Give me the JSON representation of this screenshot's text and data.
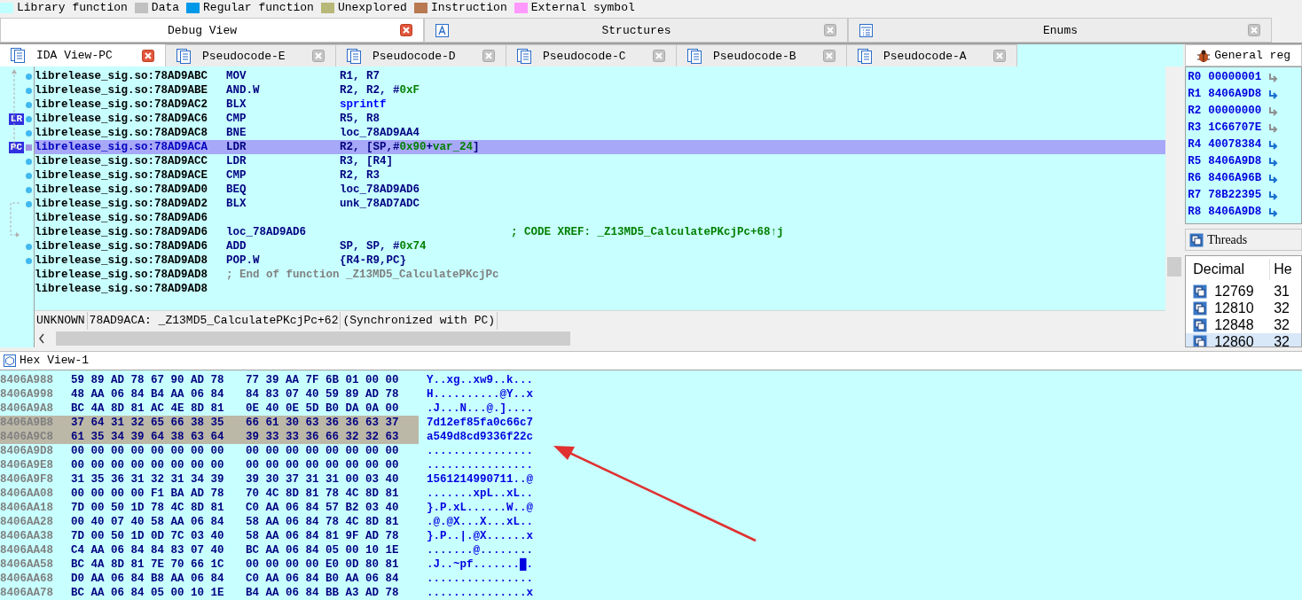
{
  "legend": [
    {
      "label": "Library function",
      "color": "#c0ffff"
    },
    {
      "label": "Data",
      "color": "#c0c0c0"
    },
    {
      "label": "Regular function",
      "color": "#0098e8"
    },
    {
      "label": "Unexplored",
      "color": "#b8b878"
    },
    {
      "label": "Instruction",
      "color": "#b87850"
    },
    {
      "label": "External symbol",
      "color": "#ff98ff"
    }
  ],
  "top_tabs": [
    {
      "label": "Debug View",
      "kind": "plain",
      "selected": true
    },
    {
      "label": "Structures",
      "kind": "struct",
      "selected": false
    },
    {
      "label": "Enums",
      "kind": "enum",
      "selected": false
    }
  ],
  "view_tabs": [
    {
      "label": "IDA View-PC",
      "selected": true
    },
    {
      "label": "Pseudocode-E",
      "selected": false
    },
    {
      "label": "Pseudocode-D",
      "selected": false
    },
    {
      "label": "Pseudocode-C",
      "selected": false
    },
    {
      "label": "Pseudocode-B",
      "selected": false
    },
    {
      "label": "Pseudocode-A",
      "selected": false
    }
  ],
  "code": {
    "lines": [
      {
        "address": "librelease_sig.so:78AD9ABC",
        "mnemonic": "MOV",
        "operands": [
          {
            "text": "R1, R7",
            "kind": "reg"
          }
        ],
        "dot": true,
        "selected": false
      },
      {
        "address": "librelease_sig.so:78AD9ABE",
        "mnemonic": "AND.W",
        "operands": [
          {
            "text": "R2, R2, #",
            "kind": "reg"
          },
          {
            "text": "0xF",
            "kind": "num"
          }
        ],
        "dot": true,
        "selected": false
      },
      {
        "address": "librelease_sig.so:78AD9AC2",
        "mnemonic": "BLX",
        "operands": [
          {
            "text": "sprintf",
            "kind": "func"
          }
        ],
        "dot": true,
        "selected": false
      },
      {
        "address": "librelease_sig.so:78AD9AC6",
        "mnemonic": "CMP",
        "operands": [
          {
            "text": "R5, R8",
            "kind": "reg"
          }
        ],
        "dot": true,
        "marker": "LR",
        "selected": false
      },
      {
        "address": "librelease_sig.so:78AD9AC8",
        "mnemonic": "BNE",
        "operands": [
          {
            "text": "loc_78AD9AA4",
            "kind": "reg"
          }
        ],
        "dot": true,
        "selected": false
      },
      {
        "address": "librelease_sig.so:78AD9ACA",
        "mnemonic": "LDR",
        "operands": [
          {
            "text": "R2, [SP,#",
            "kind": "reg"
          },
          {
            "text": "0x90",
            "kind": "num"
          },
          {
            "text": "+",
            "kind": "reg"
          },
          {
            "text": "var_24",
            "kind": "num"
          },
          {
            "text": "]",
            "kind": "reg"
          }
        ],
        "dot": true,
        "marker": "PC",
        "selected": true
      },
      {
        "address": "librelease_sig.so:78AD9ACC",
        "mnemonic": "LDR",
        "operands": [
          {
            "text": "R3, [R4]",
            "kind": "reg"
          }
        ],
        "dot": true,
        "selected": false
      },
      {
        "address": "librelease_sig.so:78AD9ACE",
        "mnemonic": "CMP",
        "operands": [
          {
            "text": "R2, R3",
            "kind": "reg"
          }
        ],
        "dot": true,
        "selected": false
      },
      {
        "address": "librelease_sig.so:78AD9AD0",
        "mnemonic": "BEQ",
        "operands": [
          {
            "text": "loc_78AD9AD6",
            "kind": "reg"
          }
        ],
        "dot": true,
        "selected": false
      },
      {
        "address": "librelease_sig.so:78AD9AD2",
        "mnemonic": "BLX",
        "operands": [
          {
            "text": "unk_78AD7ADC",
            "kind": "reg"
          }
        ],
        "dot": true,
        "selected": false
      },
      {
        "address": "librelease_sig.so:78AD9AD6",
        "dot": false,
        "selected": false
      },
      {
        "address": "librelease_sig.so:78AD9AD6",
        "label": "loc_78AD9AD6",
        "comment": {
          "text": "; CODE XREF: _Z13MD5_CalculatePKcjPc+68↑j",
          "kind": "xref"
        },
        "dot": false,
        "selected": false
      },
      {
        "address": "librelease_sig.so:78AD9AD6",
        "mnemonic": "ADD",
        "operands": [
          {
            "text": "SP, SP, #",
            "kind": "reg"
          },
          {
            "text": "0x74",
            "kind": "num"
          }
        ],
        "dot": true,
        "selected": false
      },
      {
        "address": "librelease_sig.so:78AD9AD8",
        "mnemonic": "POP.W",
        "operands": [
          {
            "text": "{R4-R9,PC}",
            "kind": "reg"
          }
        ],
        "dot": true,
        "selected": false
      },
      {
        "address": "librelease_sig.so:78AD9AD8",
        "label_comment": "; End of function _Z13MD5_CalculatePKcjPc",
        "dot": false,
        "selected": false
      },
      {
        "address": "librelease_sig.so:78AD9AD8",
        "dot": false,
        "selected": false
      }
    ],
    "status": [
      "UNKNOWN",
      "78AD9ACA: _Z13MD5_CalculatePKcjPc+62",
      "(Synchronized with PC)"
    ]
  },
  "registers": {
    "title": "General reg",
    "rows": [
      {
        "name": "R0",
        "value": "00000001",
        "pointer": false
      },
      {
        "name": "R1",
        "value": "8406A9D8",
        "pointer": true
      },
      {
        "name": "R2",
        "value": "00000000",
        "pointer": false
      },
      {
        "name": "R3",
        "value": "1C66707E",
        "pointer": false
      },
      {
        "name": "R4",
        "value": "40078384",
        "pointer": true
      },
      {
        "name": "R5",
        "value": "8406A9D8",
        "pointer": true
      },
      {
        "name": "R6",
        "value": "8406A96B",
        "pointer": true
      },
      {
        "name": "R7",
        "value": "78B22395",
        "pointer": true
      },
      {
        "name": "R8",
        "value": "8406A9D8",
        "pointer": true
      }
    ]
  },
  "threads": {
    "title": "Threads",
    "columns": [
      "Decimal",
      "He"
    ],
    "rows": [
      {
        "decimal": "12769",
        "hex": "31",
        "selected": false
      },
      {
        "decimal": "12810",
        "hex": "32",
        "selected": false
      },
      {
        "decimal": "12848",
        "hex": "32",
        "selected": false
      },
      {
        "decimal": "12860",
        "hex": "32",
        "selected": true
      }
    ]
  },
  "hex_view": {
    "title": "Hex View-1",
    "rows": [
      {
        "address": "8406A988",
        "bytes_1": "59 89 AD 78 67 90 AD 78",
        "bytes_2": "77 39 AA 7F 6B 01 00 00",
        "ascii": "Y..xg..xw9..k...",
        "selected": false
      },
      {
        "address": "8406A998",
        "bytes_1": "48 AA 06 84 B4 AA 06 84",
        "bytes_2": "84 83 07 40 59 89 AD 78",
        "ascii": "H..........@Y..x",
        "selected": false
      },
      {
        "address": "8406A9A8",
        "bytes_1": "BC 4A 8D 81 AC 4E 8D 81",
        "bytes_2": "0E 40 0E 5D B0 DA 0A 00",
        "ascii": ".J...N...@.]....",
        "selected": false
      },
      {
        "address": "8406A9B8",
        "bytes_1": "37 64 31 32 65 66 38 35",
        "bytes_2": "66 61 30 63 36 36 63 37",
        "ascii": "7d12ef85fa0c66c7",
        "selected": true
      },
      {
        "address": "8406A9C8",
        "bytes_1": "61 35 34 39 64 38 63 64",
        "bytes_2": "39 33 33 36 66 32 32 63",
        "ascii": "a549d8cd9336f22c",
        "selected": true
      },
      {
        "address": "8406A9D8",
        "bytes_1": "00 00 00 00 00 00 00 00",
        "bytes_2": "00 00 00 00 00 00 00 00",
        "ascii": "................",
        "selected": false
      },
      {
        "address": "8406A9E8",
        "bytes_1": "00 00 00 00 00 00 00 00",
        "bytes_2": "00 00 00 00 00 00 00 00",
        "ascii": "................",
        "selected": false
      },
      {
        "address": "8406A9F8",
        "bytes_1": "31 35 36 31 32 31 34 39",
        "bytes_2": "39 30 37 31 31 00 03 40",
        "ascii": "1561214990711..@",
        "selected": false
      },
      {
        "address": "8406AA08",
        "bytes_1": "00 00 00 00 F1 BA AD 78",
        "bytes_2": "70 4C 8D 81 78 4C 8D 81",
        "ascii": ".......xpL..xL..",
        "selected": false
      },
      {
        "address": "8406AA18",
        "bytes_1": "7D 00 50 1D 78 4C 8D 81",
        "bytes_2": "C0 AA 06 84 57 B2 03 40",
        "ascii": "}.P.xL......W..@",
        "selected": false
      },
      {
        "address": "8406AA28",
        "bytes_1": "00 40 07 40 58 AA 06 84",
        "bytes_2": "58 AA 06 84 78 4C 8D 81",
        "ascii": ".@.@X...X...xL..",
        "selected": false
      },
      {
        "address": "8406AA38",
        "bytes_1": "7D 00 50 1D 0D 7C 03 40",
        "bytes_2": "58 AA 06 84 81 9F AD 78",
        "ascii": "}.P..|.@X......x",
        "selected": false
      },
      {
        "address": "8406AA48",
        "bytes_1": "C4 AA 06 84 84 83 07 40",
        "bytes_2": "BC AA 06 84 05 00 10 1E",
        "ascii": ".......@........",
        "selected": false
      },
      {
        "address": "8406AA58",
        "bytes_1": "BC 4A 8D 81 7E 70 66 1C",
        "bytes_2": "00 00 00 00 E0 0D 80 81",
        "ascii": ".J..~pf.......█.",
        "selected": false
      },
      {
        "address": "8406AA68",
        "bytes_1": "D0 AA 06 84 B8 AA 06 84",
        "bytes_2": "C0 AA 06 84 B0 AA 06 84",
        "ascii": "................",
        "selected": false
      },
      {
        "address": "8406AA78",
        "bytes_1": "BC AA 06 84 05 00 10 1E",
        "bytes_2": "B4 AA 06 84 BB A3 AD 78",
        "ascii": "...............x",
        "selected": false
      }
    ]
  }
}
